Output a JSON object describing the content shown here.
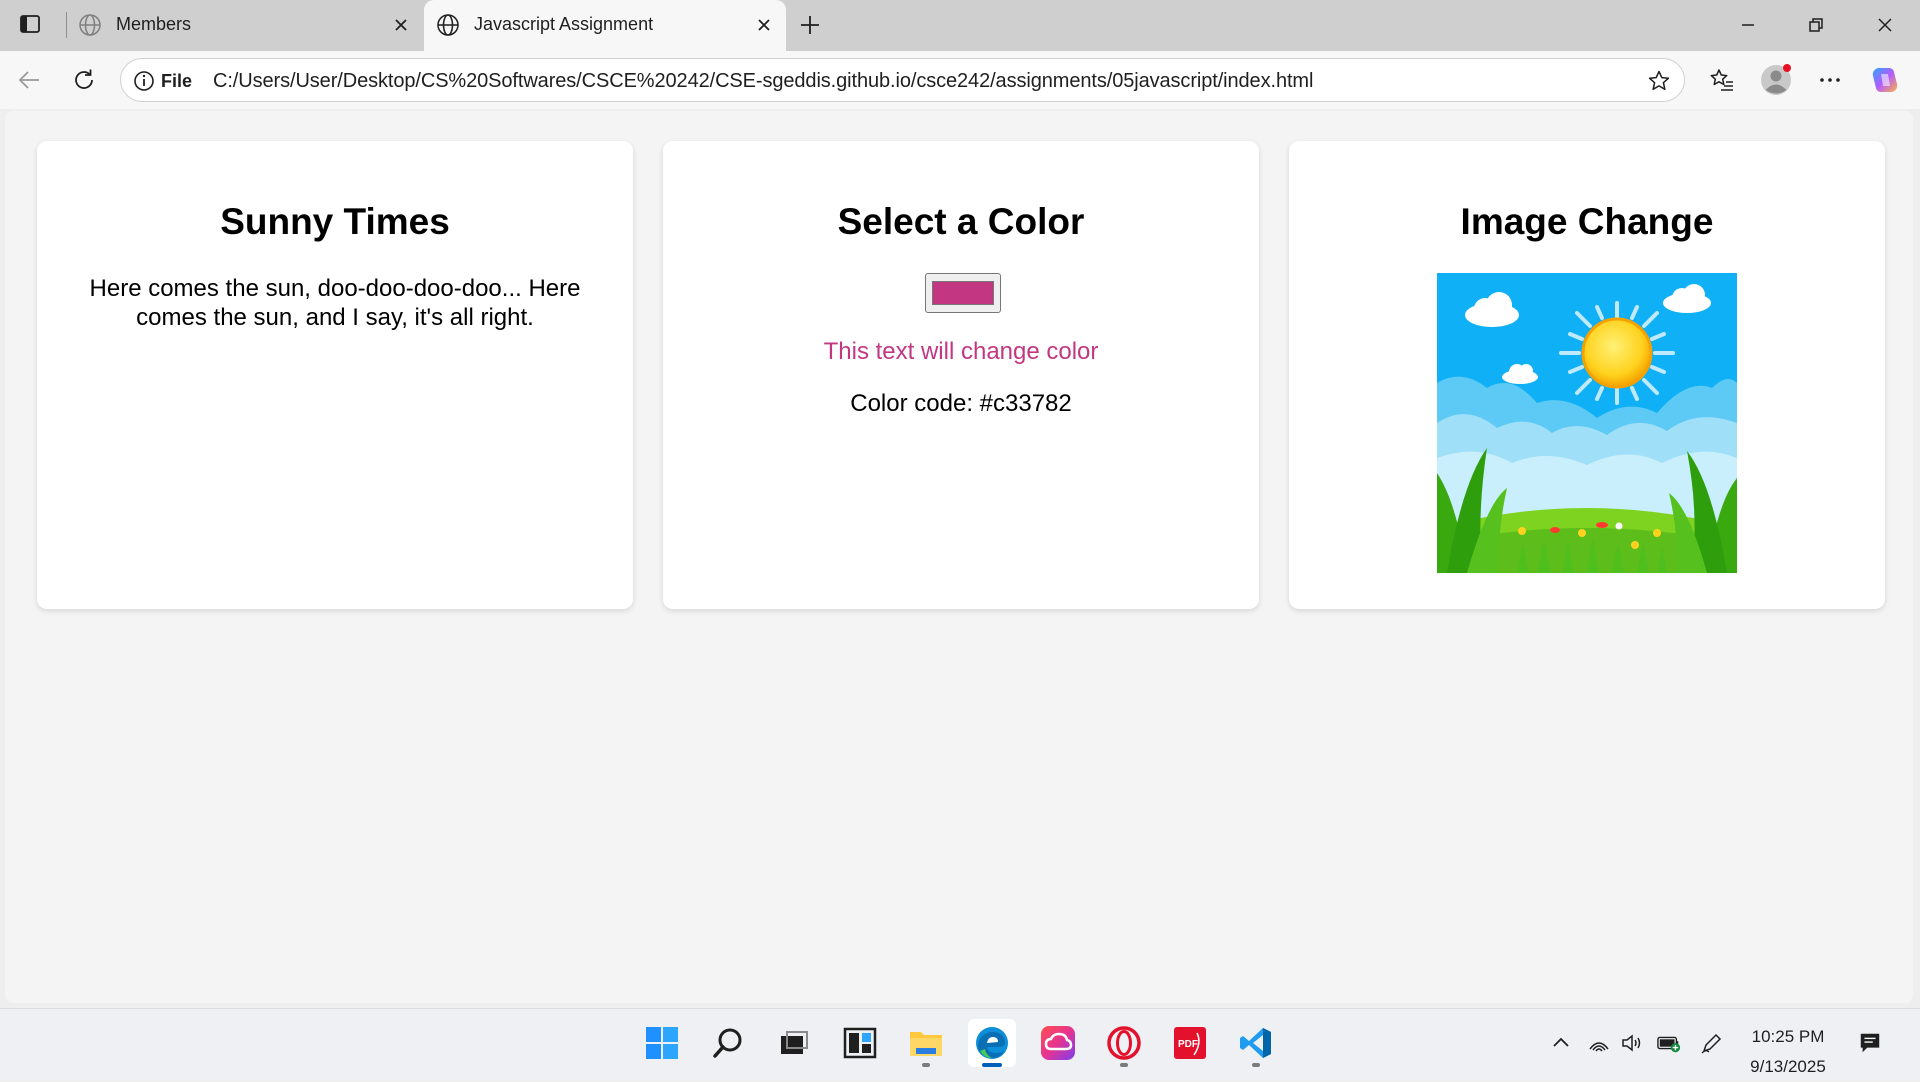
{
  "browser": {
    "tabs": [
      {
        "title": "Members",
        "active": false
      },
      {
        "title": "Javascript Assignment",
        "active": true
      }
    ],
    "address_bar": {
      "site_label": "File",
      "url": "C:/Users/User/Desktop/CS%20Softwares/CSCE%20242/CSE-sgeddis.github.io/csce242/assignments/05javascript/index.html"
    }
  },
  "page": {
    "cards": {
      "sunny": {
        "title": "Sunny Times",
        "text": "Here comes the sun, doo-doo-doo-doo... Here comes the sun, and I say, it's all right."
      },
      "color": {
        "title": "Select a Color",
        "selected_color": "#c33782",
        "change_text": "This text will change color",
        "code_text": "Color code: #c33782"
      },
      "image": {
        "title": "Image Change"
      }
    }
  },
  "taskbar": {
    "apps": [
      "start",
      "search",
      "task-view",
      "widgets",
      "file-explorer",
      "edge",
      "creative-cloud",
      "opera",
      "pdf",
      "vscode"
    ],
    "clock": {
      "time": "10:25 PM",
      "date": "9/13/2025"
    }
  },
  "colors": {
    "accent": "#c33782",
    "page_bg": "#f4f4f4",
    "card_bg": "#ffffff"
  }
}
